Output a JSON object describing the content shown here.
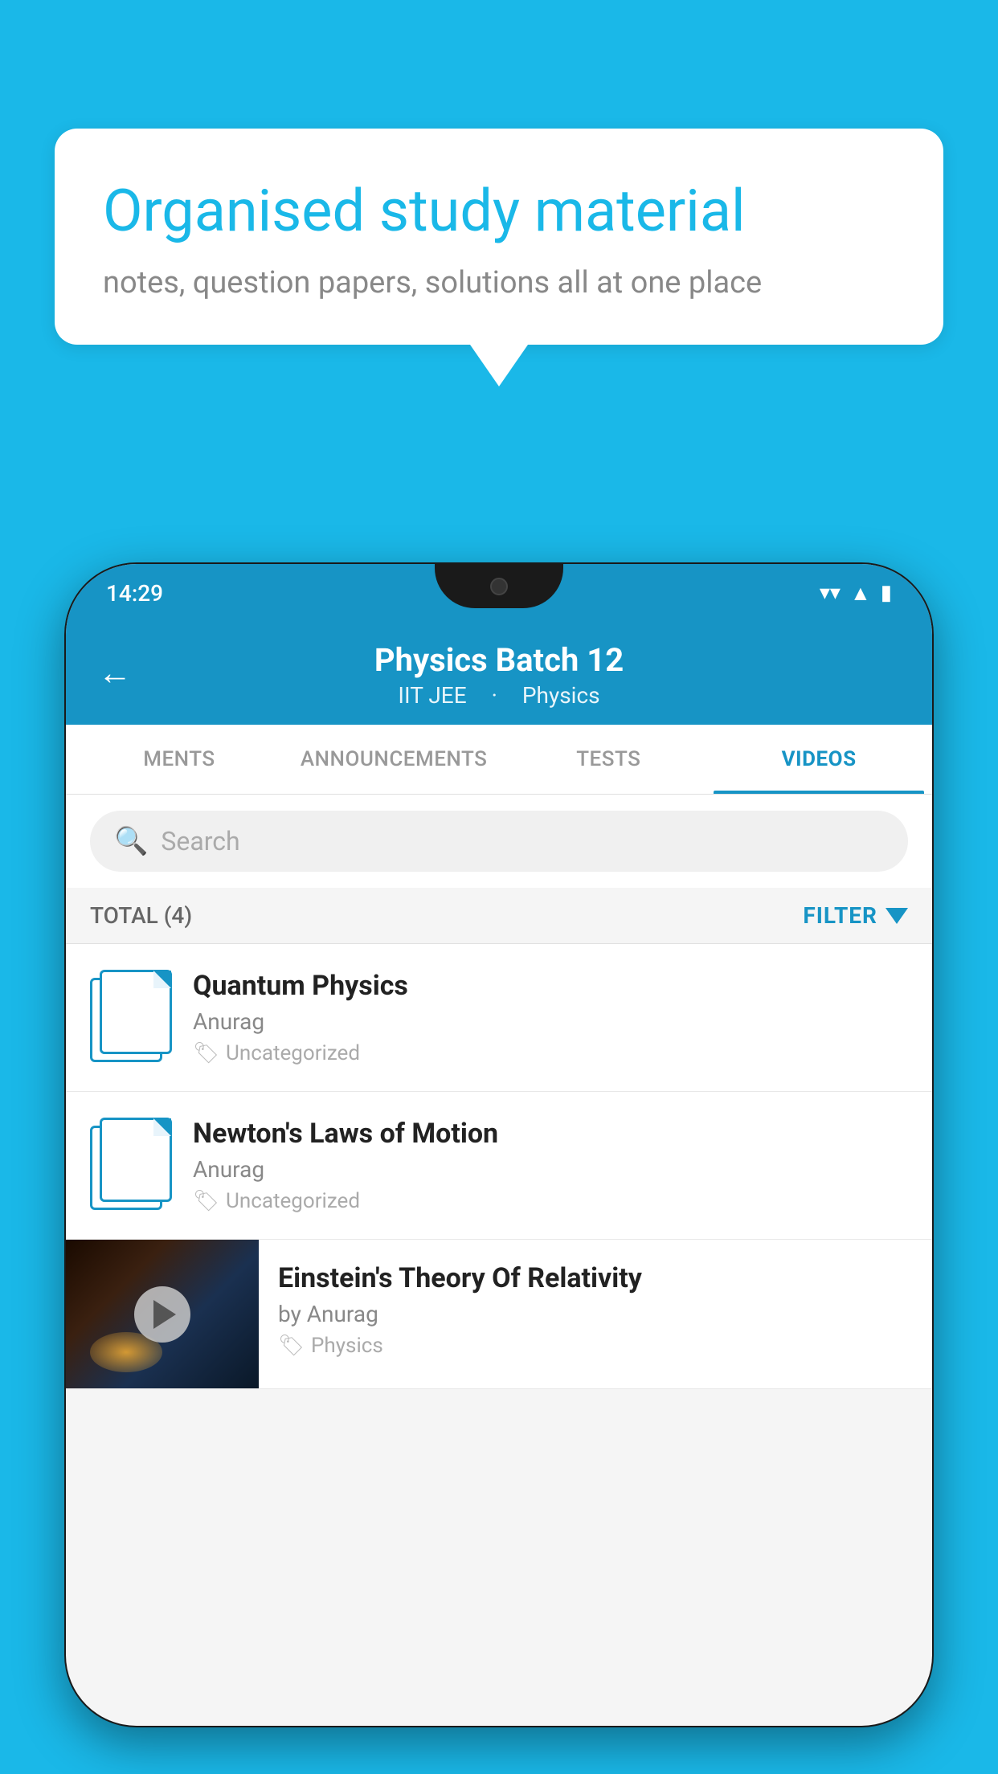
{
  "background_color": "#1ab8e8",
  "speech_bubble": {
    "title": "Organised study material",
    "subtitle": "notes, question papers, solutions all at one place"
  },
  "phone": {
    "status_bar": {
      "time": "14:29",
      "icons": [
        "wifi",
        "signal",
        "battery"
      ]
    },
    "header": {
      "back_label": "←",
      "title": "Physics Batch 12",
      "subtitle_parts": [
        "IIT JEE",
        "Physics"
      ]
    },
    "tabs": [
      {
        "label": "MENTS",
        "active": false
      },
      {
        "label": "ANNOUNCEMENTS",
        "active": false
      },
      {
        "label": "TESTS",
        "active": false
      },
      {
        "label": "VIDEOS",
        "active": true
      }
    ],
    "search": {
      "placeholder": "Search"
    },
    "filter_bar": {
      "total_label": "TOTAL (4)",
      "filter_label": "FILTER"
    },
    "video_items": [
      {
        "title": "Quantum Physics",
        "author": "Anurag",
        "tag": "Uncategorized",
        "has_thumbnail": false
      },
      {
        "title": "Newton's Laws of Motion",
        "author": "Anurag",
        "tag": "Uncategorized",
        "has_thumbnail": false
      },
      {
        "title": "Einstein's Theory Of Relativity",
        "author": "by Anurag",
        "tag": "Physics",
        "has_thumbnail": true
      }
    ]
  }
}
